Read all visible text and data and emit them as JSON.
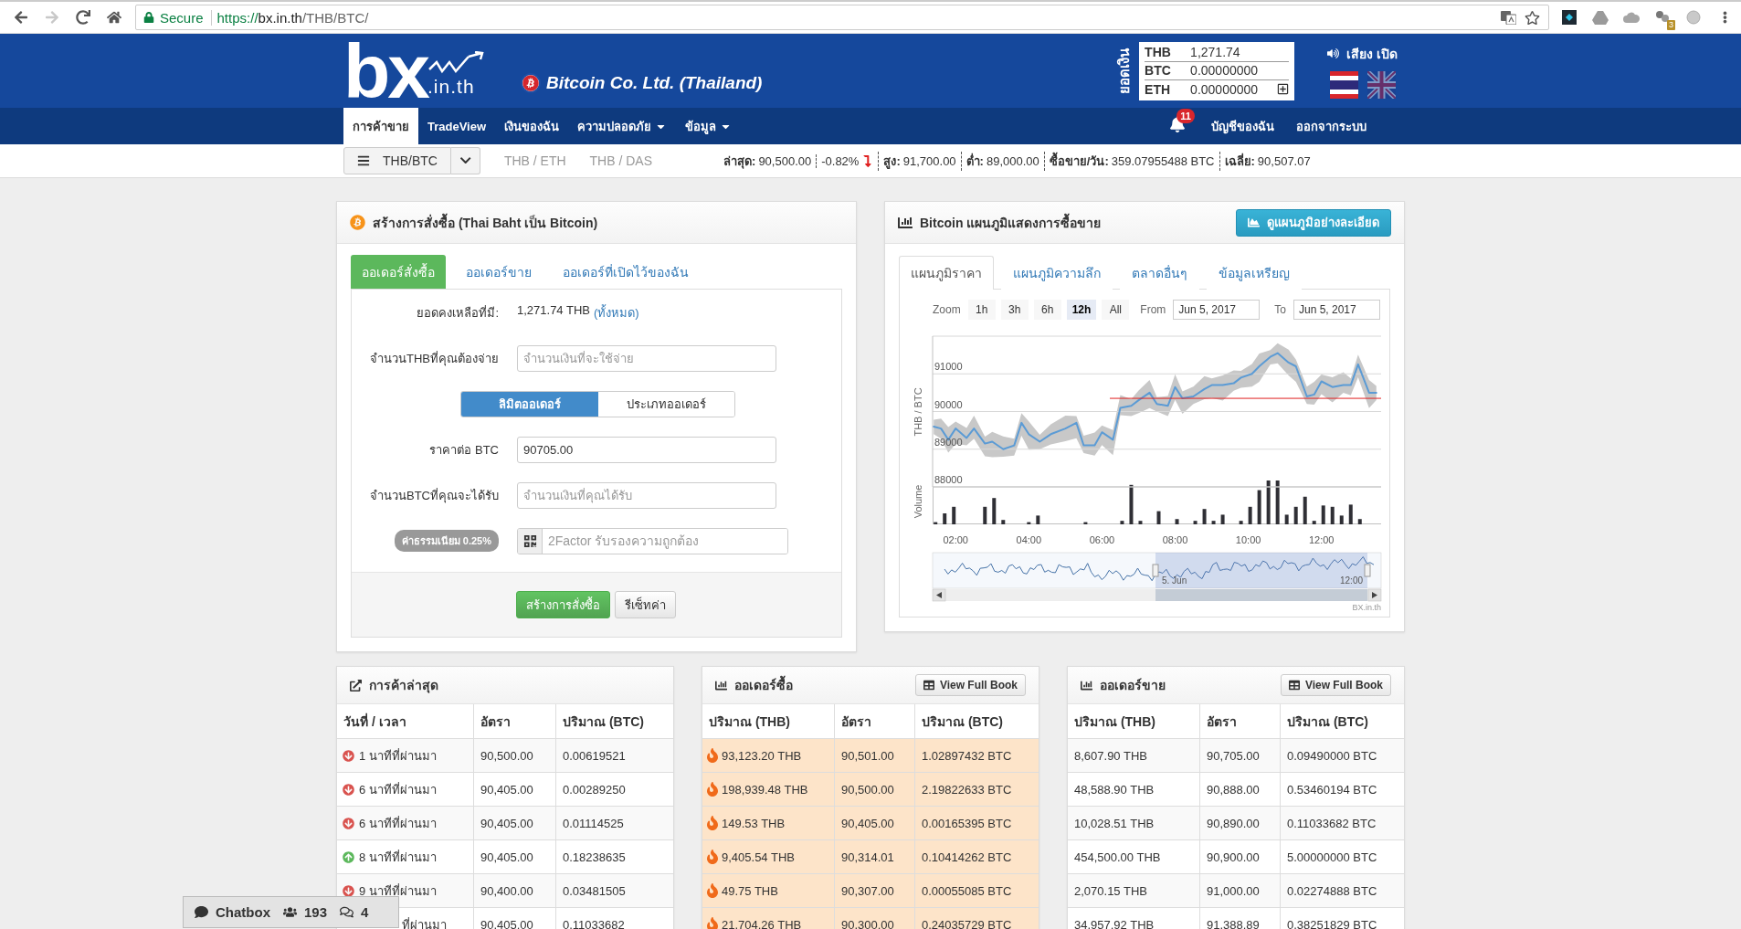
{
  "browser": {
    "nav_buttons": [
      {
        "kind": "back",
        "disabled": false
      },
      {
        "kind": "forward",
        "disabled": true
      },
      {
        "kind": "reload",
        "disabled": false
      },
      {
        "kind": "home",
        "disabled": false
      }
    ],
    "address": {
      "secure_label": "Secure",
      "scheme": "https://",
      "host": "bx.in.th",
      "path": "/THB/BTC/"
    },
    "toolbar_icons": [
      {
        "kind": "translate"
      },
      {
        "kind": "star"
      },
      {
        "kind": "tile"
      },
      {
        "kind": "drive"
      },
      {
        "kind": "cloud"
      },
      {
        "kind": "molecule",
        "badge": "3"
      },
      {
        "kind": "circle"
      },
      {
        "kind": "menu"
      }
    ]
  },
  "header": {
    "logo": {
      "main": "bx",
      "sub": ".in.th"
    },
    "company": "Bitcoin Co. Ltd. (Thailand)",
    "balance": {
      "title": "ยอดเงิน",
      "rows": [
        {
          "currency": "THB",
          "amount": "1,271.74",
          "expand": false
        },
        {
          "currency": "BTC",
          "amount": "0.00000000",
          "expand": false
        },
        {
          "currency": "ETH",
          "amount": "0.00000000",
          "expand": true
        }
      ]
    },
    "sound": {
      "label": "เสียง เปิด"
    },
    "languages": [
      {
        "kind": "thai",
        "selected": true
      },
      {
        "kind": "uk",
        "selected": false
      }
    ]
  },
  "nav": {
    "items": [
      {
        "label": "การค้าขาย",
        "selected": true,
        "dropdown": false
      },
      {
        "label": "TradeView",
        "selected": false,
        "dropdown": false
      },
      {
        "label": "เงินของฉัน",
        "selected": false,
        "dropdown": false
      },
      {
        "label": "ความปลอดภัย",
        "selected": false,
        "dropdown": true
      },
      {
        "label": "ข้อมูล",
        "selected": false,
        "dropdown": true
      }
    ],
    "notifications": "11",
    "links": [
      "บัญชีของฉัน",
      "ออกจากระบบ"
    ]
  },
  "ticker": {
    "market": "THB/BTC",
    "other_markets": [
      "THB / ETH",
      "THB / DAS"
    ],
    "stats": [
      {
        "kind": "labeled",
        "label": "ล่าสุด:",
        "value": "90,500.00"
      },
      {
        "kind": "change",
        "value": "-0.82%",
        "falling": true
      },
      {
        "kind": "labeled",
        "label": "สูง:",
        "value": "91,700.00"
      },
      {
        "kind": "labeled",
        "label": "ต่ำ:",
        "value": "89,000.00"
      },
      {
        "kind": "labeled",
        "label": "ซื้อขาย/วัน:",
        "value": "359.07955488 BTC"
      },
      {
        "kind": "labeled",
        "label": "เฉลี่ย:",
        "value": "90,507.07"
      }
    ]
  },
  "order_panel": {
    "title": "สร้างการสั่งซื้อ (Thai Baht เป็น Bitcoin)",
    "tabs": [
      {
        "label": "ออเดอร์สั่งซื้อ",
        "selected": true
      },
      {
        "label": "ออเดอร์ขาย",
        "selected": false
      },
      {
        "label": "ออเดอร์ที่เปิดไว้ของฉัน",
        "selected": false
      }
    ],
    "rows": [
      {
        "kind": "balance",
        "label": "ยอดคงเหลือที่มี:",
        "value": "1,271.74 THB",
        "link": "(ทั้งหมด)"
      },
      {
        "kind": "input",
        "label": "จำนวนTHBที่คุณต้องจ่าย",
        "placeholder": "จำนวนเงินที่จะใช้จ่าย"
      },
      {
        "kind": "toggle",
        "options": [
          {
            "label": "ลิมิตออเดอร์",
            "selected": true
          },
          {
            "label": "ประเภทออเดอร์",
            "selected": false
          }
        ]
      },
      {
        "kind": "input",
        "label": "ราคาต่อ BTC",
        "value": "90705.00"
      },
      {
        "kind": "input",
        "label": "จำนวนBTCที่คุณจะได้รับ",
        "placeholder": "จำนวนเงินที่คุณได้รับ"
      },
      {
        "kind": "twofactor",
        "badge": "ค่าธรรมเนียม 0.25%",
        "placeholder": "2Factor รับรองความถูกต้อง"
      }
    ],
    "buttons": [
      {
        "kind": "primary",
        "label": "สร้างการสั่งซื้อ"
      },
      {
        "kind": "default",
        "label": "รีเซ็ทค่า"
      }
    ]
  },
  "chart_panel": {
    "title": "Bitcoin แผนภูมิแสดงการซื้อขาย",
    "detail_button": "ดูแผนภูมิอย่างละเอียด",
    "tabs": [
      {
        "label": "แผนภูมิราคา",
        "selected": true
      },
      {
        "label": "แผนภูมิความลึก",
        "selected": false
      },
      {
        "label": "ตลาดอื่นๆ",
        "selected": false
      },
      {
        "label": "ข้อมูลเหรียญ",
        "selected": false
      }
    ],
    "range_selector": {
      "zoom_label": "Zoom",
      "buttons": [
        {
          "label": "1h",
          "selected": false
        },
        {
          "label": "3h",
          "selected": false
        },
        {
          "label": "6h",
          "selected": false
        },
        {
          "label": "12h",
          "selected": true
        },
        {
          "label": "All",
          "selected": false
        }
      ],
      "from_label": "From",
      "from": "Jun 5, 2017",
      "to_label": "To",
      "to": "Jun 5, 2017"
    },
    "volume_title": "Volume",
    "navigator_labels": [
      "5. Jun",
      "12:00"
    ],
    "credit": "BX.in.th",
    "chart_data": {
      "type": "line",
      "ylabel": "THB / BTC",
      "x": [
        1.4,
        1.6,
        1.8,
        2.0,
        2.3,
        2.5,
        2.8,
        3.0,
        3.3,
        3.6,
        3.8,
        4.0,
        4.3,
        4.6,
        5.0,
        5.3,
        5.5,
        5.8,
        6.0,
        6.3,
        6.5,
        6.8,
        7.0,
        7.3,
        7.5,
        7.8,
        8.0,
        8.2,
        8.5,
        8.8,
        9.0,
        9.3,
        9.6,
        9.8,
        10.1,
        10.3,
        10.6,
        10.8,
        11.1,
        11.3,
        11.6,
        11.8,
        12.0,
        12.3,
        12.6,
        12.8,
        13.0,
        13.3,
        13.5
      ],
      "series": [
        {
          "color": "#5b9bd5",
          "values": [
            89600,
            89550,
            89250,
            89550,
            89300,
            89550,
            89150,
            89200,
            89000,
            89100,
            89700,
            89400,
            89200,
            89400,
            89550,
            89700,
            89100,
            89100,
            89450,
            89250,
            90100,
            90150,
            90300,
            90500,
            90200,
            90150,
            90650,
            90350,
            90400,
            90600,
            90700,
            90700,
            90750,
            90900,
            91000,
            91200,
            91450,
            91550,
            91300,
            91200,
            90400,
            90450,
            90800,
            90650,
            90700,
            90700,
            91250,
            90500,
            90500
          ]
        }
      ],
      "xlim": [
        1.37,
        13.63
      ],
      "ylim": [
        88000,
        92000
      ],
      "xticks": [
        {
          "value": 2,
          "label": "02:00"
        },
        {
          "value": 4,
          "label": "04:00"
        },
        {
          "value": 6,
          "label": "06:00"
        },
        {
          "value": 8,
          "label": "08:00"
        },
        {
          "value": 10,
          "label": "10:00"
        },
        {
          "value": 12,
          "label": "12:00"
        }
      ],
      "yticks": [
        88000,
        89000,
        90000,
        91000
      ],
      "grid": true,
      "ref_lines": [
        {
          "axis": "y",
          "value": 90350,
          "color": "#e02020"
        }
      ]
    }
  },
  "trades": {
    "title": "การค้าล่าสุด",
    "columns": [
      "วันที่ / เวลา",
      "อัตรา",
      "ปริมาณ (BTC)"
    ],
    "rows": [
      {
        "kind": "down",
        "time": "1 นาทีที่ผ่านมา",
        "rate": "90,500.00",
        "amount": "0.00619521"
      },
      {
        "kind": "down",
        "time": "6 นาทีที่ผ่านมา",
        "rate": "90,405.00",
        "amount": "0.00289250"
      },
      {
        "kind": "down",
        "time": "6 นาทีที่ผ่านมา",
        "rate": "90,405.00",
        "amount": "0.01114525"
      },
      {
        "kind": "up",
        "time": "8 นาทีที่ผ่านมา",
        "rate": "90,405.00",
        "amount": "0.18238635"
      },
      {
        "kind": "down",
        "time": "9 นาทีที่ผ่านมา",
        "rate": "90,400.00",
        "amount": "0.03481505"
      },
      {
        "kind": "covered",
        "time": "ที่ผ่านมา",
        "rate": "90,405.00",
        "amount": "0.11033682"
      }
    ]
  },
  "books": [
    {
      "kind": "buy",
      "title": "ออเดอร์ซื้อ",
      "button": "View Full Book",
      "columns": [
        "ปริมาณ (THB)",
        "อัตรา",
        "ปริมาณ (BTC)"
      ],
      "rows": [
        {
          "thb": "93,123.20 THB",
          "rate": "90,501.00",
          "btc": "1.02897432 BTC"
        },
        {
          "thb": "198,939.48 THB",
          "rate": "90,500.00",
          "btc": "2.19822633 BTC"
        },
        {
          "thb": "149.53 THB",
          "rate": "90,405.00",
          "btc": "0.00165395 BTC"
        },
        {
          "thb": "9,405.54 THB",
          "rate": "90,314.01",
          "btc": "0.10414262 BTC"
        },
        {
          "thb": "49.75 THB",
          "rate": "90,307.00",
          "btc": "0.00055085 BTC"
        },
        {
          "thb": "21,704.26 THB",
          "rate": "90,300.00",
          "btc": "0.24035729 BTC"
        }
      ]
    },
    {
      "kind": "sell",
      "title": "ออเดอร์ขาย",
      "button": "View Full Book",
      "columns": [
        "ปริมาณ (THB)",
        "อัตรา",
        "ปริมาณ (BTC)"
      ],
      "rows": [
        {
          "thb": "8,607.90 THB",
          "rate": "90,705.00",
          "btc": "0.09490000 BTC"
        },
        {
          "thb": "48,588.90 THB",
          "rate": "90,888.00",
          "btc": "0.53460194 BTC"
        },
        {
          "thb": "10,028.51 THB",
          "rate": "90,890.00",
          "btc": "0.11033682 BTC"
        },
        {
          "thb": "454,500.00 THB",
          "rate": "90,900.00",
          "btc": "5.00000000 BTC"
        },
        {
          "thb": "2,070.15 THB",
          "rate": "91,000.00",
          "btc": "0.02274888 BTC"
        },
        {
          "thb": "34,957.92 THB",
          "rate": "91,388.89",
          "btc": "0.38251829 BTC"
        }
      ]
    }
  ],
  "chatbox": {
    "label": "Chatbox",
    "users": "193",
    "messages": "4"
  }
}
